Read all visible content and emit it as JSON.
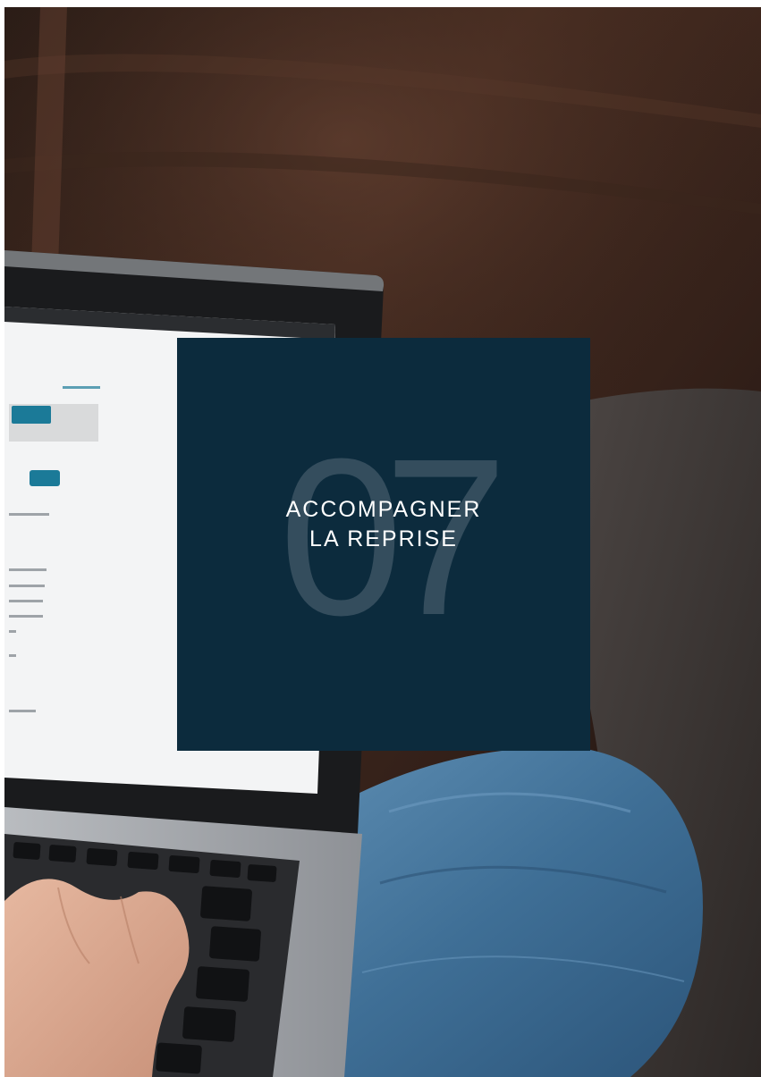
{
  "chapter": {
    "number": "07",
    "title_line_1": "ACCOMPAGNER",
    "title_line_2": "LA REPRISE"
  },
  "colors": {
    "panel_background": "#0c2b3d",
    "chapter_number": "#3b5363",
    "title_text": "#ffffff"
  },
  "photo": {
    "subject": "person-typing-on-laptop-on-knees"
  }
}
